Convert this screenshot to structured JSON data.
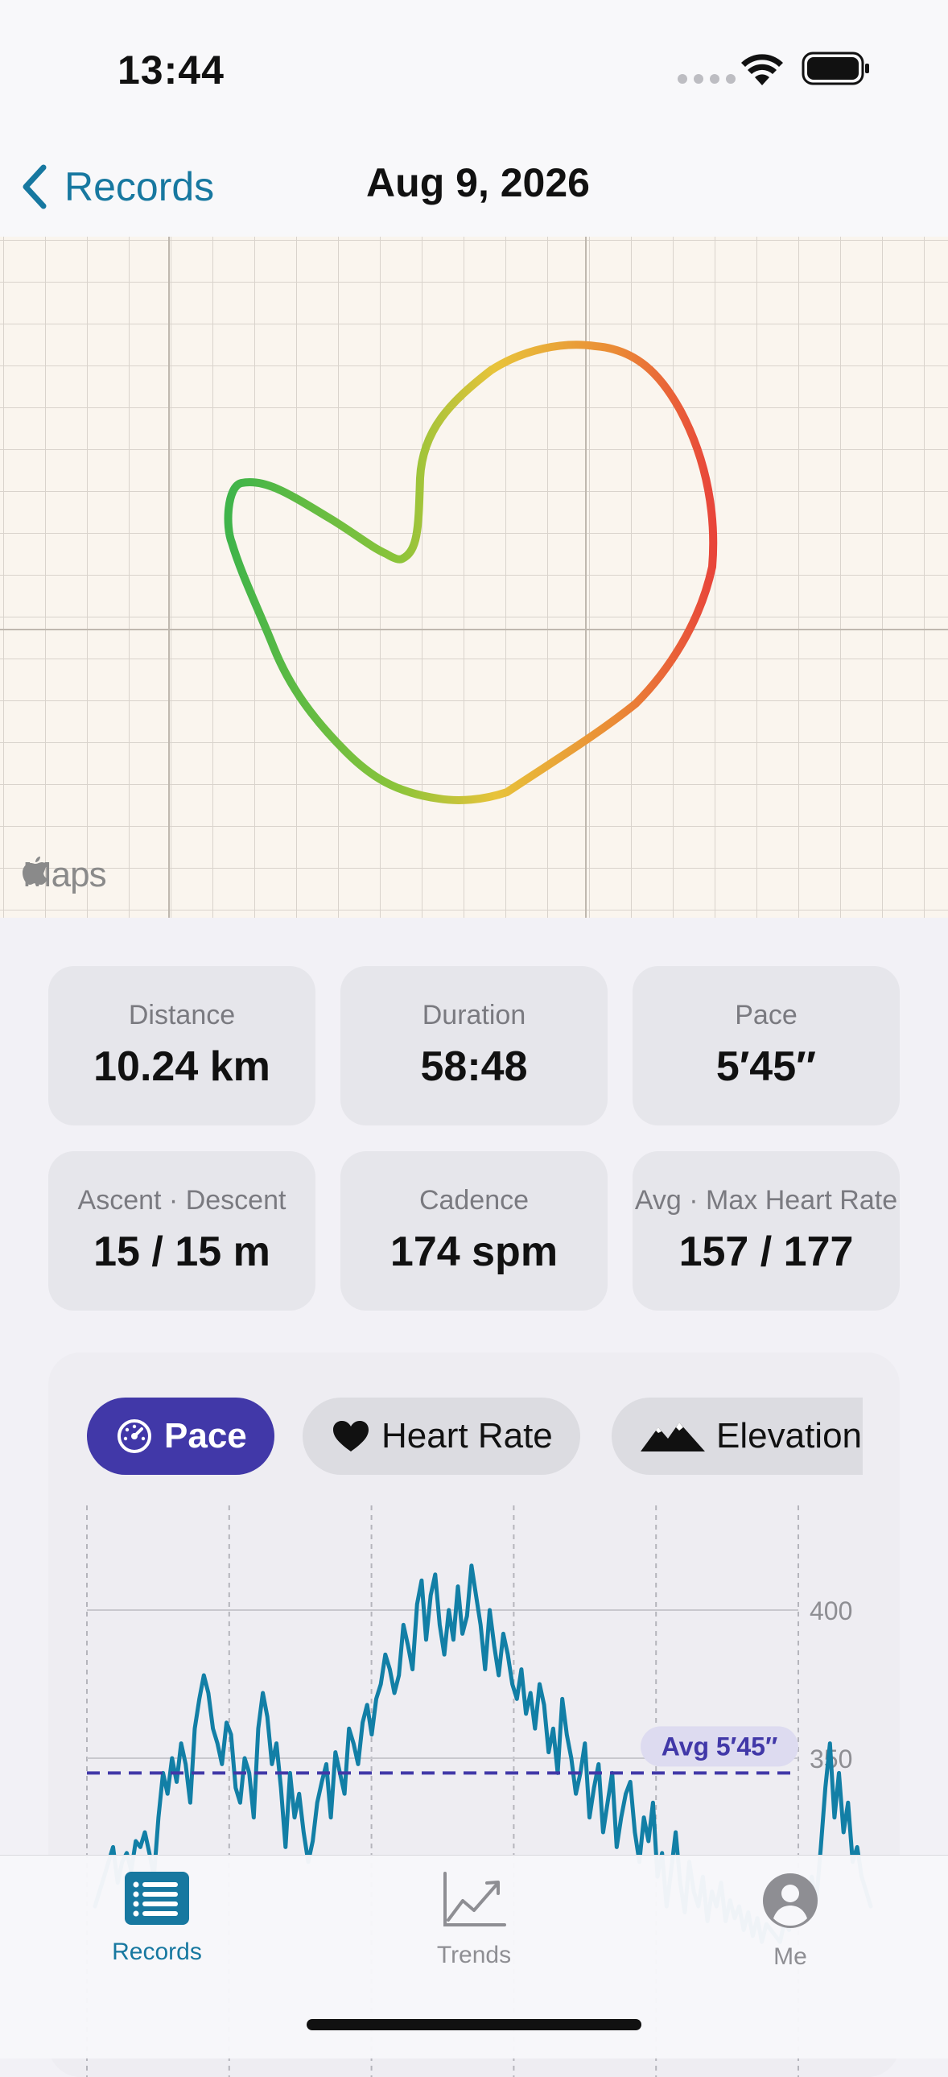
{
  "status_bar": {
    "time": "13:44"
  },
  "nav": {
    "back_label": "Records",
    "title": "Aug 9, 2026"
  },
  "map": {
    "attribution": "Maps"
  },
  "stats": [
    {
      "label": "Distance",
      "value": "10.24 km"
    },
    {
      "label": "Duration",
      "value": "58:48"
    },
    {
      "label": "Pace",
      "value": "5′45″"
    },
    {
      "label": "Ascent · Descent",
      "value": "15 / 15 m"
    },
    {
      "label": "Cadence",
      "value": "174 spm"
    },
    {
      "label": "Avg · Max Heart Rate",
      "value": "157 / 177"
    }
  ],
  "chart_tabs": [
    {
      "label": "Pace",
      "icon": "speedometer-icon",
      "selected": true
    },
    {
      "label": "Heart Rate",
      "icon": "heart-icon",
      "selected": false
    },
    {
      "label": "Elevation",
      "icon": "mountains-icon",
      "selected": false
    }
  ],
  "chart_data": {
    "type": "line",
    "y_ticks": [
      350,
      400
    ],
    "ylim": [
      300,
      430
    ],
    "avg_label": "Avg 5′45″",
    "avg_value": 345,
    "grid": true,
    "series": [
      {
        "values": [
          300,
          305,
          310,
          315,
          320,
          308,
          315,
          318,
          312,
          322,
          320,
          325,
          318,
          310,
          330,
          345,
          338,
          350,
          342,
          355,
          348,
          335,
          360,
          370,
          378,
          372,
          360,
          355,
          348,
          362,
          358,
          340,
          335,
          350,
          345,
          330,
          360,
          372,
          364,
          348,
          355,
          340,
          320,
          345,
          330,
          338,
          325,
          315,
          322,
          335,
          342,
          348,
          330,
          352,
          345,
          338,
          360,
          355,
          348,
          362,
          368,
          358,
          370,
          375,
          385,
          380,
          372,
          378,
          395,
          388,
          380,
          402,
          410,
          390,
          405,
          412,
          395,
          385,
          400,
          390,
          408,
          392,
          398,
          415,
          405,
          395,
          380,
          400,
          388,
          378,
          392,
          385,
          375,
          370,
          380,
          365,
          372,
          360,
          375,
          368,
          352,
          360,
          345,
          370,
          358,
          350,
          338,
          345,
          355,
          330,
          340,
          348,
          325,
          335,
          345,
          320,
          330,
          338,
          342,
          325,
          315,
          330,
          322,
          335,
          310,
          318,
          300,
          312,
          325,
          308,
          298,
          315,
          305,
          300,
          310,
          295,
          305,
          300,
          308,
          295,
          302,
          296,
          300,
          292,
          298,
          290,
          296,
          288,
          294,
          292,
          290,
          288,
          295,
          292,
          300,
          296,
          305,
          298,
          310,
          302,
          320,
          340,
          355,
          330,
          345,
          325,
          335,
          315,
          320,
          310,
          305,
          300
        ]
      }
    ]
  },
  "tab_bar": [
    {
      "label": "Records",
      "icon": "records-icon",
      "selected": true
    },
    {
      "label": "Trends",
      "icon": "trends-icon",
      "selected": false
    },
    {
      "label": "Me",
      "icon": "person-icon",
      "selected": false
    }
  ],
  "colors": {
    "accent": "#1778A0",
    "tab_selected": "#4138A8",
    "line": "#127FA6",
    "avg": "#4138A8",
    "route_fast": "#E8453A",
    "route_mid": "#E8C33A",
    "route_slow": "#3FB44A"
  }
}
